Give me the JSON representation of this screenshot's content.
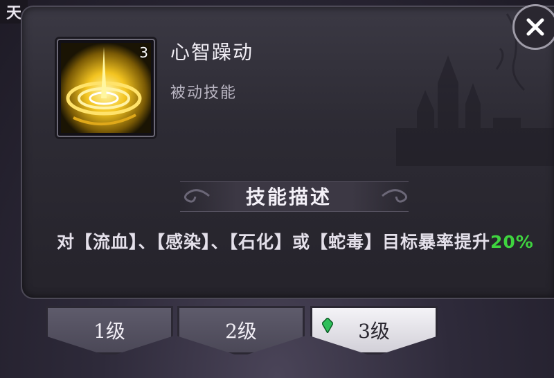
{
  "corner": {
    "label": "天"
  },
  "skill": {
    "name": "心智躁动",
    "type": "被动技能",
    "level": "3"
  },
  "description": {
    "header": "技能描述",
    "text_main": "对【流血】、【感染】、【石化】或【蛇毒】目标暴率提升",
    "highlight": "20%"
  },
  "levels": [
    {
      "label": "1级",
      "active": false
    },
    {
      "label": "2级",
      "active": false
    },
    {
      "label": "3级",
      "active": true
    }
  ],
  "colors": {
    "highlight_green": "#3fd43f",
    "panel_bg": "#2d2b34",
    "active_tab": "#f4f3f7"
  },
  "icons": {
    "skill_icon": "golden-vortex-icon",
    "close": "close-icon",
    "gem": "green-gem-icon"
  }
}
